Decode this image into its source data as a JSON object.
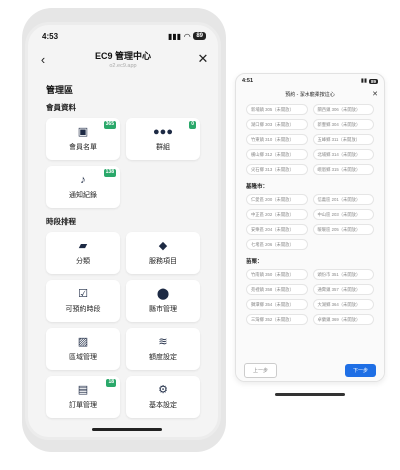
{
  "main": {
    "status": {
      "time": "4:53",
      "battery": "89"
    },
    "header": {
      "title": "EC9 管理中心",
      "url": "o2.ec9.app"
    },
    "section_title": "管理區",
    "members_group": {
      "title": "會員資料",
      "cards": [
        {
          "label": "會員名單",
          "icon": "contacts-icon",
          "badge": "365"
        },
        {
          "label": "群組",
          "icon": "users-icon",
          "badge": "0"
        },
        {
          "label": "通知紀錄",
          "icon": "bell-icon",
          "badge": "138"
        }
      ]
    },
    "schedule_group": {
      "title": "時段排程",
      "cards": [
        {
          "label": "分類",
          "icon": "folder-icon",
          "badge": ""
        },
        {
          "label": "服務項目",
          "icon": "box-icon",
          "badge": ""
        },
        {
          "label": "可預約時段",
          "icon": "calendar-check-icon",
          "badge": ""
        },
        {
          "label": "縣市管理",
          "icon": "map-pin-icon",
          "badge": ""
        },
        {
          "label": "區域管理",
          "icon": "map-icon",
          "badge": ""
        },
        {
          "label": "額度設定",
          "icon": "layers-icon",
          "badge": ""
        },
        {
          "label": "訂單管理",
          "icon": "receipt-icon",
          "badge": "18"
        },
        {
          "label": "基本設定",
          "icon": "gear-icon",
          "badge": ""
        }
      ]
    }
  },
  "secondary": {
    "status": {
      "time": "4:51",
      "battery": "89"
    },
    "header_title": "預約 - 潔水龍柔按這心",
    "top_items": [
      "新埔鎮 305（未開放）",
      "關西鎮 306（未開放）",
      "湖口鄉 303（未開放）",
      "新豐鄉 304（未開放）",
      "竹東鎮 310（未開放）",
      "五峰鄉 311（未開放）",
      "橫山鄉 312（未開放）",
      "北埔鄉 314（未開放）",
      "尖石鄉 313（未開放）",
      "峨眉鄉 315（未開放）"
    ],
    "regions": [
      {
        "name": "基隆市：",
        "items": [
          "仁愛區 200（未開放）",
          "信義區 201（未開放）",
          "中正區 202（未開放）",
          "中山區 203（未開放）",
          "安樂區 204（未開放）",
          "暖暖區 205（未開放）",
          "七堵區 206（未開放）"
        ]
      },
      {
        "name": "苗栗：",
        "items": [
          "竹南鎮 350（未開放）",
          "頭份市 351（未開放）",
          "苑裡鎮 358（未開放）",
          "通霄鎮 357（未開放）",
          "獅潭鄉 354（未開放）",
          "大湖鄉 364（未開放）",
          "三灣鄉 352（未開放）",
          "卓蘭鎮 369（未開放）"
        ]
      }
    ],
    "buttons": {
      "prev": "上一步",
      "next": "下一步"
    }
  }
}
